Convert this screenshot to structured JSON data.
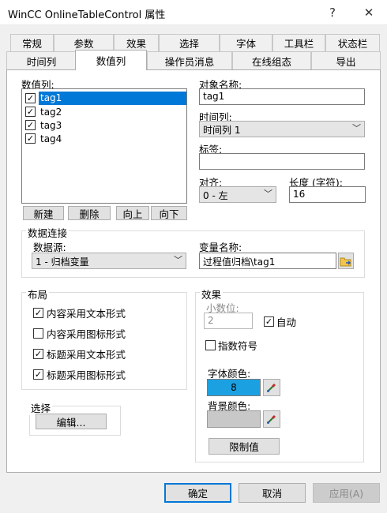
{
  "window": {
    "title": "WinCC OnlineTableControl 属性",
    "help_label": "?",
    "close_label": "✕"
  },
  "tabs": {
    "row1": [
      "常规",
      "参数",
      "效果",
      "选择",
      "字体",
      "工具栏",
      "状态栏"
    ],
    "row2": [
      "时间列",
      "数值列",
      "操作员消息",
      "在线组态",
      "导出"
    ],
    "active": "数值列"
  },
  "value_columns": {
    "label": "数值列:",
    "items": [
      {
        "name": "tag1",
        "checked": true,
        "selected": true
      },
      {
        "name": "tag2",
        "checked": true,
        "selected": false
      },
      {
        "name": "tag3",
        "checked": true,
        "selected": false
      },
      {
        "name": "tag4",
        "checked": true,
        "selected": false
      }
    ],
    "buttons": {
      "new": "新建",
      "delete": "删除",
      "up": "向上",
      "down": "向下"
    }
  },
  "object_name": {
    "label": "对象名称:",
    "value": "tag1"
  },
  "time_column": {
    "label": "时间列:",
    "value": "时间列 1"
  },
  "tag_label": {
    "label": "标签:",
    "value": ""
  },
  "align": {
    "label": "对齐:",
    "value": "0 - 左"
  },
  "length": {
    "label": "长度 (字符):",
    "value": "16"
  },
  "data_connection": {
    "legend": "数据连接",
    "source_label": "数据源:",
    "source_value": "1 - 归档变量",
    "var_label": "变量名称:",
    "var_value": "过程值归档\\tag1"
  },
  "layout": {
    "legend": "布局",
    "options": [
      {
        "label": "内容采用文本形式",
        "checked": true
      },
      {
        "label": "内容采用图标形式",
        "checked": false
      },
      {
        "label": "标题采用文本形式",
        "checked": true
      },
      {
        "label": "标题采用图标形式",
        "checked": true
      }
    ]
  },
  "effect": {
    "legend": "效果",
    "decimals_label": "小数位:",
    "decimals_value": "2",
    "auto_label": "自动",
    "auto_checked": true,
    "exponent_label": "指数符号",
    "exponent_checked": false,
    "font_color_label": "字体颜色:",
    "font_color_value": "8",
    "font_color": "#1ba1e2",
    "bg_color_label": "背景颜色:",
    "bg_color_value": "",
    "bg_color": "#c8c8c8",
    "limits_label": "限制值"
  },
  "selection": {
    "legend": "选择",
    "edit_label": "编辑..."
  },
  "footer": {
    "ok": "确定",
    "cancel": "取消",
    "apply": "应用(A)"
  },
  "colors": {
    "accent": "#0078d7",
    "panel": "#ffffff",
    "window": "#f0f0f0"
  }
}
